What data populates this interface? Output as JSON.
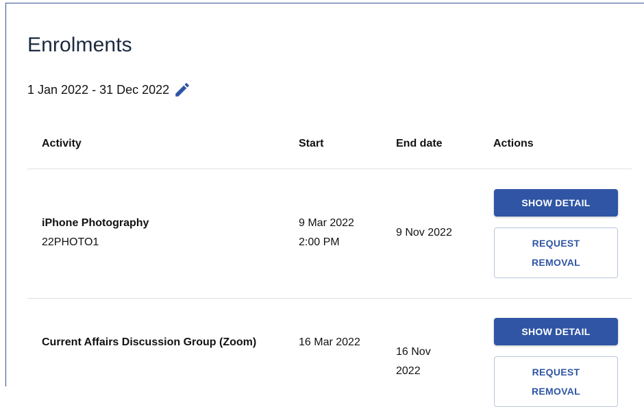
{
  "page": {
    "title": "Enrolments",
    "date_range": "1 Jan 2022 - 31 Dec 2022"
  },
  "table": {
    "headers": {
      "activity": "Activity",
      "start": "Start",
      "end_date": "End date",
      "actions": "Actions"
    },
    "rows": [
      {
        "activity_name": "iPhone Photography",
        "activity_code": "22PHOTO1",
        "start_date": "9 Mar 2022",
        "start_time": "2:00 PM",
        "end_date": "9 Nov 2022",
        "show_detail_label": "SHOW DETAIL",
        "request_removal_label": "REQUEST REMOVAL"
      },
      {
        "activity_name": "Current Affairs Discussion Group (Zoom)",
        "start_date": "16 Mar 2022",
        "end_date": "16 Nov 2022",
        "show_detail_label": "SHOW DETAIL",
        "request_removal_label": "REQUEST REMOVAL"
      }
    ]
  },
  "colors": {
    "primary": "#2f55a4",
    "frame_border": "#2f4f8f",
    "divider": "#dcdfe4"
  },
  "icons": {
    "edit": "pencil-icon"
  }
}
